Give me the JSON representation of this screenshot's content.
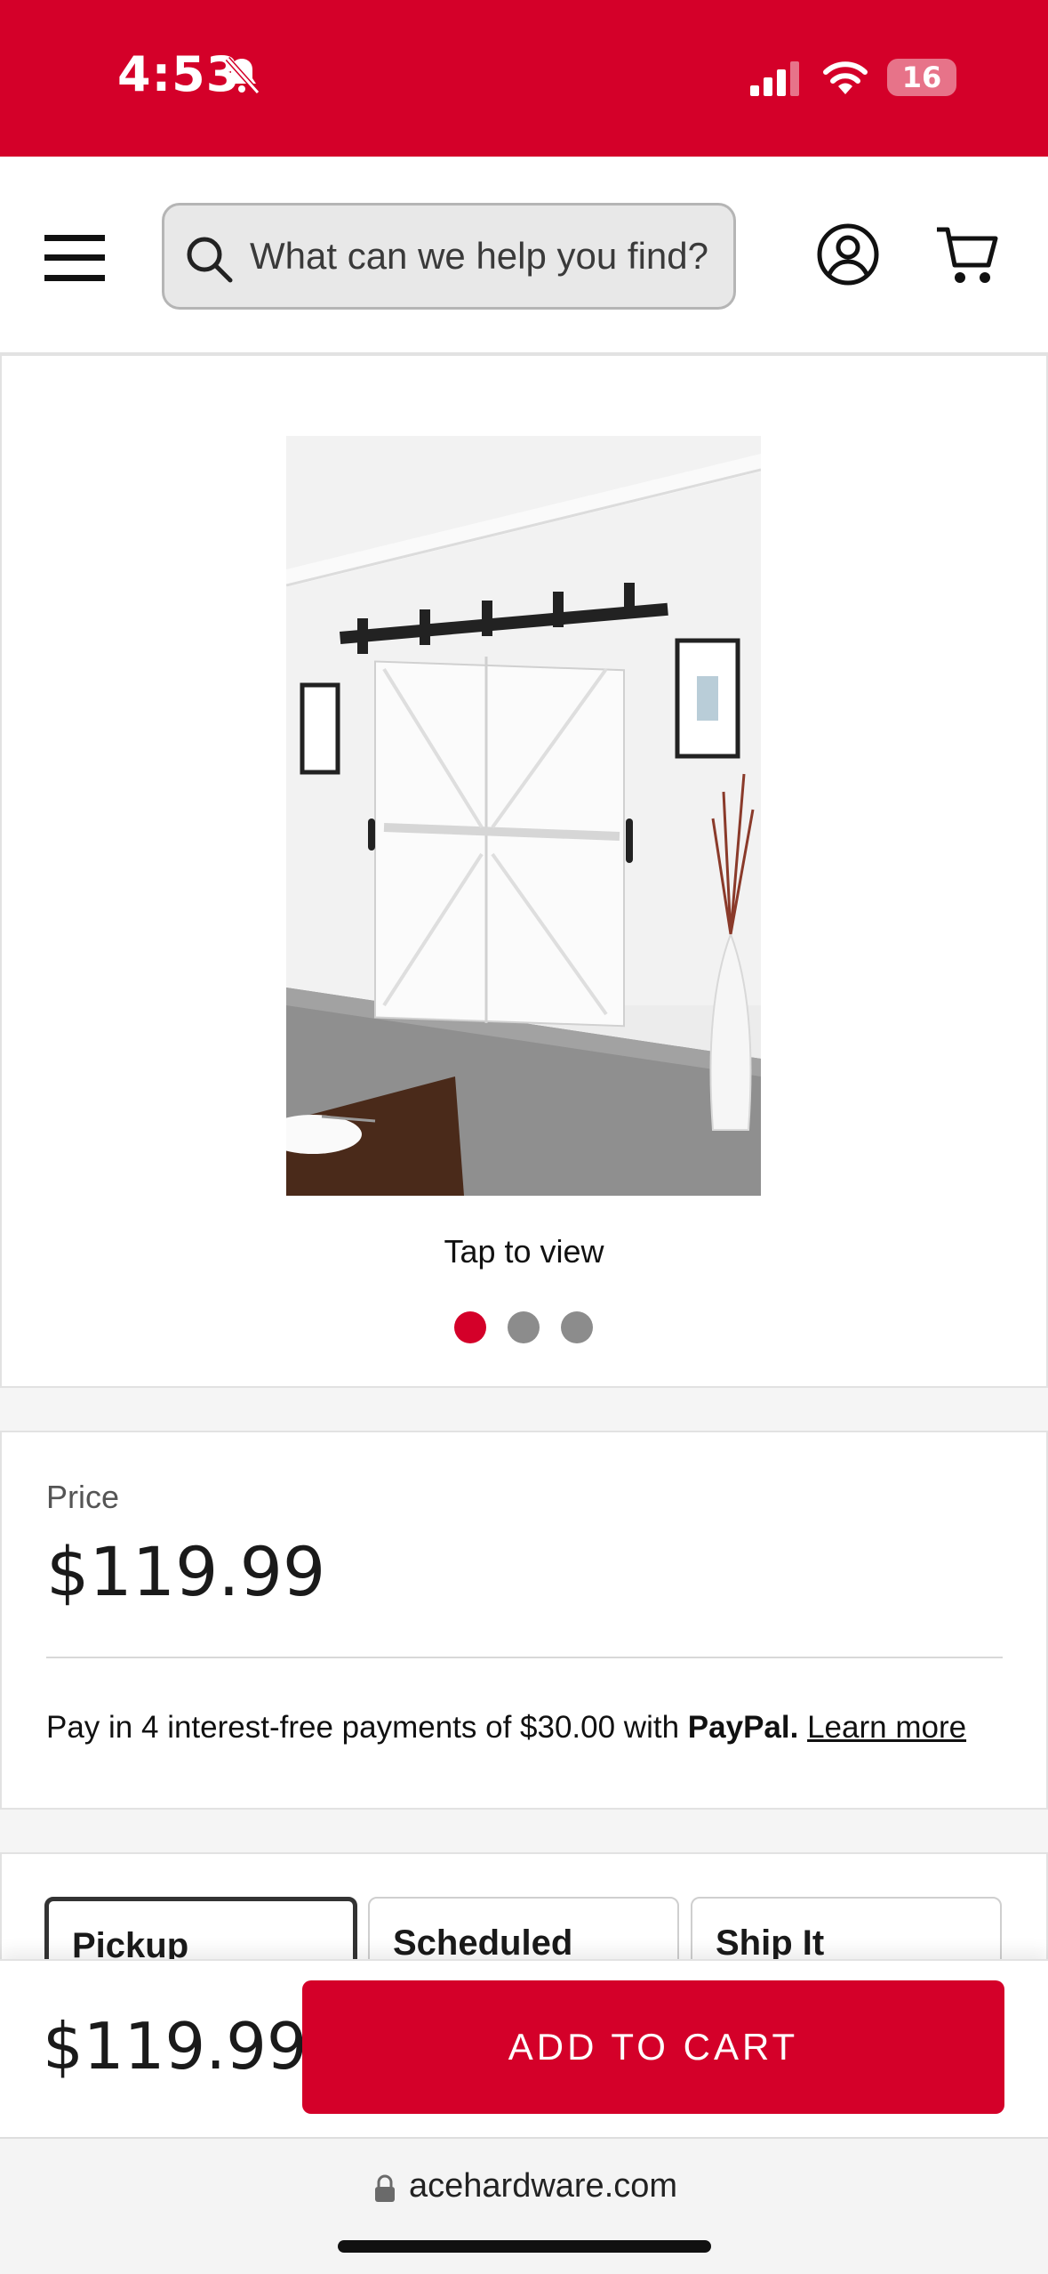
{
  "status_bar": {
    "time": "4:53",
    "battery": "16"
  },
  "header": {
    "search": {
      "placeholder": "What can we help you find?"
    }
  },
  "gallery": {
    "tap_label": "Tap to view",
    "image_count": 3,
    "active_index": 0
  },
  "price": {
    "label": "Price",
    "value": "$119.99",
    "paypal_prefix": "Pay in 4 interest-free payments of $30.00 with",
    "paypal_brand": "PayPal.",
    "learn_more": "Learn more"
  },
  "fulfillment": {
    "tabs": [
      {
        "label": "Pickup",
        "selected": true
      },
      {
        "label": "Scheduled",
        "selected": false
      },
      {
        "label": "Ship It",
        "selected": false
      }
    ]
  },
  "cart_bar": {
    "price": "$119.99",
    "button": "ADD TO CART"
  },
  "browser": {
    "url": "acehardware.com"
  },
  "colors": {
    "brand": "#d40029",
    "dot_inactive": "#8c8c8c"
  }
}
